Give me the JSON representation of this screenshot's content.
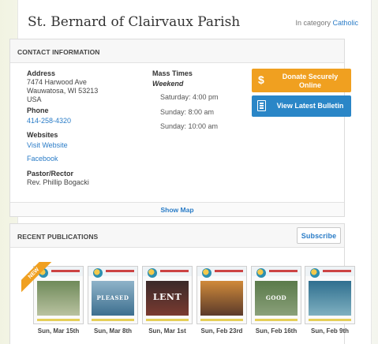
{
  "header": {
    "title": "St. Bernard of Clairvaux Parish",
    "category_prefix": "In category",
    "category_link": "Catholic"
  },
  "contact": {
    "heading": "CONTACT INFORMATION",
    "address_label": "Address",
    "address_line1": "7474 Harwood Ave",
    "address_line2": "Wauwatosa, WI 53213",
    "address_line3": "USA",
    "phone_label": "Phone",
    "phone": "414-258-4320",
    "websites_label": "Websites",
    "website_link": "Visit Website",
    "facebook_link": "Facebook",
    "pastor_label": "Pastor/Rector",
    "pastor_name": "Rev. Phillip Bogacki",
    "show_map": "Show Map"
  },
  "mass": {
    "title": "Mass Times",
    "subtitle": "Weekend",
    "times": [
      "Saturday: 4:00 pm",
      "Sunday: 8:00 am",
      "Sunday: 10:00 am"
    ]
  },
  "actions": {
    "donate_icon": "$",
    "donate_label": "Donate Securely Online",
    "bulletin_label": "View Latest Bulletin",
    "colors": {
      "donate": "#f0a020",
      "bulletin": "#2a86c7"
    }
  },
  "publications": {
    "heading": "RECENT PUBLICATIONS",
    "subscribe": "Subscribe",
    "new_badge": "NEW",
    "items": [
      {
        "date": "Sun, Mar 15th",
        "cover_text": ""
      },
      {
        "date": "Sun, Mar 8th",
        "cover_text": "PLEASED"
      },
      {
        "date": "Sun, Mar 1st",
        "cover_text": "LENT"
      },
      {
        "date": "Sun, Feb 23rd",
        "cover_text": ""
      },
      {
        "date": "Sun, Feb 16th",
        "cover_text": "GOOD"
      },
      {
        "date": "Sun, Feb 9th",
        "cover_text": ""
      }
    ]
  }
}
